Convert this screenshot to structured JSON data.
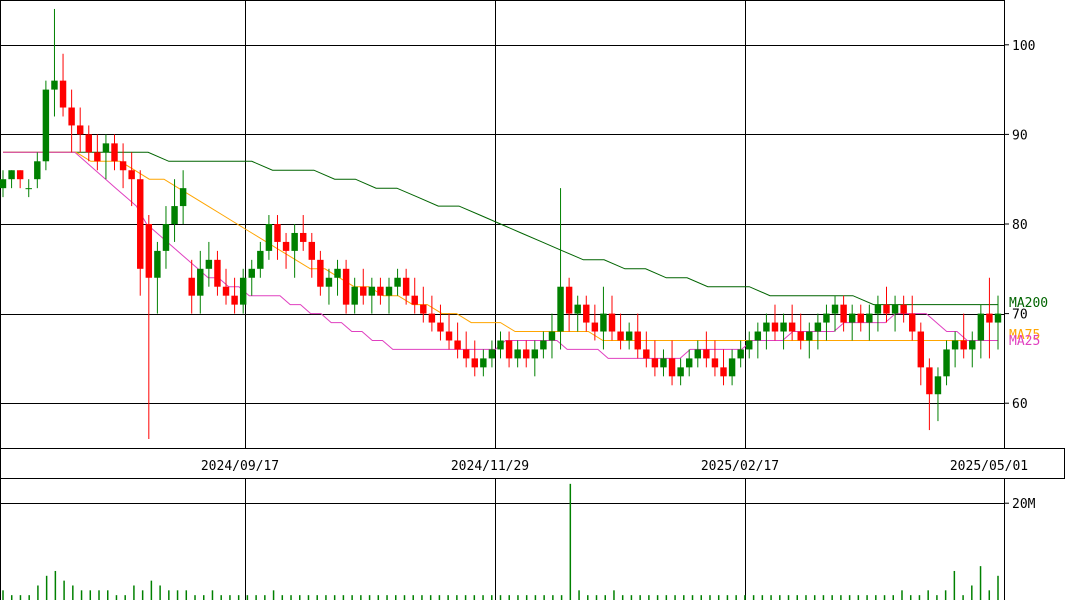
{
  "chart_data": {
    "type": "candlestick",
    "colors": {
      "up": "#008000",
      "down": "#ff0000",
      "ma25": "#e040c0",
      "ma75": "#ffa500",
      "ma200": "#006400",
      "volume": "#008000",
      "grid": "#000000"
    },
    "x_dates": [
      "2024/09/17",
      "2024/11/29",
      "2025/02/17",
      "2025/05/01"
    ],
    "price_axis": {
      "ticks": [
        "60",
        "70",
        "80",
        "90",
        "100"
      ],
      "ylim": [
        55,
        105
      ]
    },
    "volume_axis": {
      "ticks": [
        "20M"
      ],
      "ylim": [
        0,
        25000000
      ]
    },
    "ma_labels": {
      "ma200": "MA200",
      "ma75": "MA75",
      "ma25": "MA25"
    },
    "ohlc": [
      [
        84,
        86,
        83,
        85
      ],
      [
        85,
        86,
        84,
        86
      ],
      [
        86,
        86,
        84,
        85
      ],
      [
        84,
        85,
        83,
        84
      ],
      [
        85,
        88,
        84,
        87
      ],
      [
        87,
        96,
        86,
        95
      ],
      [
        95,
        104,
        92,
        96
      ],
      [
        96,
        99,
        92,
        93
      ],
      [
        93,
        95,
        88,
        91
      ],
      [
        91,
        93,
        88,
        90
      ],
      [
        90,
        91,
        87,
        88
      ],
      [
        88,
        90,
        86,
        87
      ],
      [
        88,
        90,
        85,
        89
      ],
      [
        89,
        90,
        86,
        87
      ],
      [
        87,
        89,
        84,
        86
      ],
      [
        86,
        88,
        82,
        85
      ],
      [
        85,
        86,
        72,
        75
      ],
      [
        80,
        81,
        56,
        74
      ],
      [
        74,
        78,
        70,
        77
      ],
      [
        77,
        82,
        75,
        80
      ],
      [
        80,
        85,
        78,
        82
      ],
      [
        82,
        86,
        80,
        84
      ],
      [
        74,
        76,
        70,
        72
      ],
      [
        72,
        77,
        70,
        75
      ],
      [
        75,
        78,
        73,
        76
      ],
      [
        76,
        77,
        72,
        73
      ],
      [
        73,
        75,
        71,
        72
      ],
      [
        72,
        74,
        70,
        71
      ],
      [
        71,
        75,
        70,
        74
      ],
      [
        74,
        76,
        72,
        75
      ],
      [
        75,
        78,
        74,
        77
      ],
      [
        77,
        81,
        76,
        80
      ],
      [
        80,
        81,
        76,
        78
      ],
      [
        78,
        79,
        75,
        77
      ],
      [
        77,
        80,
        74,
        79
      ],
      [
        79,
        81,
        77,
        78
      ],
      [
        78,
        79,
        74,
        76
      ],
      [
        76,
        77,
        72,
        73
      ],
      [
        73,
        75,
        71,
        74
      ],
      [
        74,
        76,
        72,
        75
      ],
      [
        75,
        76,
        70,
        71
      ],
      [
        71,
        74,
        70,
        73
      ],
      [
        73,
        75,
        71,
        72
      ],
      [
        72,
        74,
        70,
        73
      ],
      [
        73,
        74,
        71,
        72
      ],
      [
        72,
        74,
        70,
        73
      ],
      [
        73,
        75,
        72,
        74
      ],
      [
        74,
        75,
        71,
        72
      ],
      [
        72,
        74,
        70,
        71
      ],
      [
        71,
        73,
        69,
        70
      ],
      [
        70,
        72,
        68,
        69
      ],
      [
        69,
        71,
        67,
        68
      ],
      [
        68,
        70,
        66,
        67
      ],
      [
        67,
        69,
        65,
        66
      ],
      [
        66,
        68,
        64,
        65
      ],
      [
        65,
        67,
        63,
        64
      ],
      [
        64,
        66,
        63,
        65
      ],
      [
        65,
        67,
        64,
        66
      ],
      [
        66,
        68,
        65,
        67
      ],
      [
        67,
        68,
        64,
        65
      ],
      [
        65,
        67,
        64,
        66
      ],
      [
        66,
        67,
        64,
        65
      ],
      [
        65,
        67,
        63,
        66
      ],
      [
        66,
        68,
        65,
        67
      ],
      [
        67,
        70,
        65,
        68
      ],
      [
        68,
        84,
        66,
        73
      ],
      [
        73,
        74,
        68,
        70
      ],
      [
        70,
        72,
        68,
        71
      ],
      [
        71,
        72,
        68,
        69
      ],
      [
        69,
        71,
        67,
        68
      ],
      [
        68,
        73,
        66,
        70
      ],
      [
        70,
        72,
        67,
        68
      ],
      [
        68,
        70,
        66,
        67
      ],
      [
        67,
        69,
        66,
        68
      ],
      [
        68,
        70,
        65,
        66
      ],
      [
        66,
        68,
        64,
        65
      ],
      [
        65,
        67,
        63,
        64
      ],
      [
        64,
        66,
        63,
        65
      ],
      [
        65,
        67,
        62,
        63
      ],
      [
        63,
        65,
        62,
        64
      ],
      [
        64,
        66,
        63,
        65
      ],
      [
        65,
        67,
        64,
        66
      ],
      [
        66,
        68,
        64,
        65
      ],
      [
        65,
        67,
        63,
        64
      ],
      [
        64,
        66,
        62,
        63
      ],
      [
        63,
        66,
        62,
        65
      ],
      [
        65,
        67,
        64,
        66
      ],
      [
        66,
        68,
        65,
        67
      ],
      [
        67,
        69,
        65,
        68
      ],
      [
        68,
        70,
        66,
        69
      ],
      [
        69,
        71,
        67,
        68
      ],
      [
        68,
        70,
        66,
        69
      ],
      [
        69,
        71,
        67,
        68
      ],
      [
        68,
        70,
        66,
        67
      ],
      [
        67,
        69,
        65,
        68
      ],
      [
        68,
        70,
        66,
        69
      ],
      [
        69,
        71,
        67,
        70
      ],
      [
        70,
        72,
        68,
        71
      ],
      [
        71,
        72,
        68,
        69
      ],
      [
        69,
        71,
        67,
        70
      ],
      [
        70,
        71,
        68,
        69
      ],
      [
        69,
        71,
        67,
        70
      ],
      [
        70,
        72,
        68,
        71
      ],
      [
        71,
        73,
        69,
        70
      ],
      [
        70,
        72,
        68,
        71
      ],
      [
        71,
        72,
        69,
        70
      ],
      [
        70,
        72,
        67,
        68
      ],
      [
        68,
        69,
        62,
        64
      ],
      [
        64,
        65,
        57,
        61
      ],
      [
        61,
        64,
        58,
        63
      ],
      [
        63,
        67,
        62,
        66
      ],
      [
        66,
        68,
        64,
        67
      ],
      [
        67,
        70,
        65,
        66
      ],
      [
        66,
        68,
        64,
        67
      ],
      [
        67,
        71,
        65,
        70
      ],
      [
        70,
        74,
        65,
        69
      ],
      [
        69,
        72,
        66,
        70
      ]
    ],
    "ma25": [
      88,
      88,
      88,
      88,
      88,
      88,
      88,
      88,
      87,
      86,
      85,
      84,
      83,
      82,
      80,
      79,
      78,
      77,
      76,
      75,
      74,
      74,
      73,
      73,
      72,
      72,
      72,
      72,
      71,
      71,
      70,
      70,
      69,
      69,
      68,
      68,
      67,
      67,
      66,
      66,
      66,
      66,
      66,
      66,
      66,
      66,
      66,
      66,
      66,
      67,
      67,
      67,
      67,
      67,
      67,
      66,
      66,
      66,
      66,
      65,
      65,
      65,
      65,
      65,
      65,
      65,
      65,
      66,
      66,
      66,
      66,
      66,
      66,
      67,
      67,
      67,
      67,
      68,
      68,
      68,
      68,
      68,
      69,
      69,
      69,
      69,
      69,
      70,
      70,
      70,
      70,
      69,
      68,
      68,
      67,
      67,
      67,
      67
    ],
    "ma75": [
      88,
      88,
      88,
      88,
      88,
      88,
      87,
      87,
      87,
      86,
      85,
      85,
      84,
      83,
      82,
      81,
      80,
      79,
      78,
      77,
      76,
      75,
      75,
      74,
      73,
      73,
      72,
      72,
      71,
      71,
      70,
      70,
      69,
      69,
      69,
      68,
      68,
      68,
      68,
      68,
      68,
      67,
      67,
      67,
      67,
      67,
      67,
      67,
      67,
      67,
      67,
      67,
      67,
      67,
      67,
      67,
      67,
      67,
      67,
      67,
      67,
      67,
      67,
      67,
      67,
      67,
      67,
      67,
      67
    ],
    "ma200": [
      88,
      88,
      88,
      88,
      88,
      88,
      88,
      88,
      87,
      87,
      87,
      87,
      87,
      86,
      86,
      86,
      85,
      85,
      84,
      84,
      83,
      82,
      82,
      81,
      80,
      79,
      78,
      77,
      76,
      76,
      75,
      75,
      74,
      74,
      73,
      73,
      73,
      72,
      72,
      72,
      72,
      72,
      71,
      71,
      71,
      71,
      71,
      71,
      71
    ],
    "volume": [
      2,
      1,
      1,
      1,
      3,
      5,
      6,
      4,
      3,
      2,
      2,
      2,
      2,
      1,
      1,
      3,
      2,
      4,
      3,
      2,
      2,
      2,
      1,
      1,
      2,
      1,
      1,
      1,
      1,
      1,
      1,
      2,
      1,
      1,
      1,
      1,
      1,
      1,
      1,
      1,
      1,
      1,
      1,
      1,
      1,
      1,
      1,
      1,
      1,
      1,
      1,
      1,
      1,
      1,
      1,
      1,
      1,
      1,
      1,
      1,
      1,
      1,
      1,
      1,
      1,
      24,
      2,
      1,
      1,
      1,
      2,
      1,
      1,
      1,
      1,
      1,
      1,
      1,
      1,
      1,
      1,
      1,
      1,
      1,
      1,
      1,
      1,
      1,
      1,
      1,
      1,
      1,
      1,
      1,
      1,
      1,
      1,
      1,
      1,
      1,
      1,
      1,
      1,
      2,
      1,
      1,
      2,
      1,
      2,
      6,
      1,
      3,
      7,
      2,
      5
    ]
  }
}
